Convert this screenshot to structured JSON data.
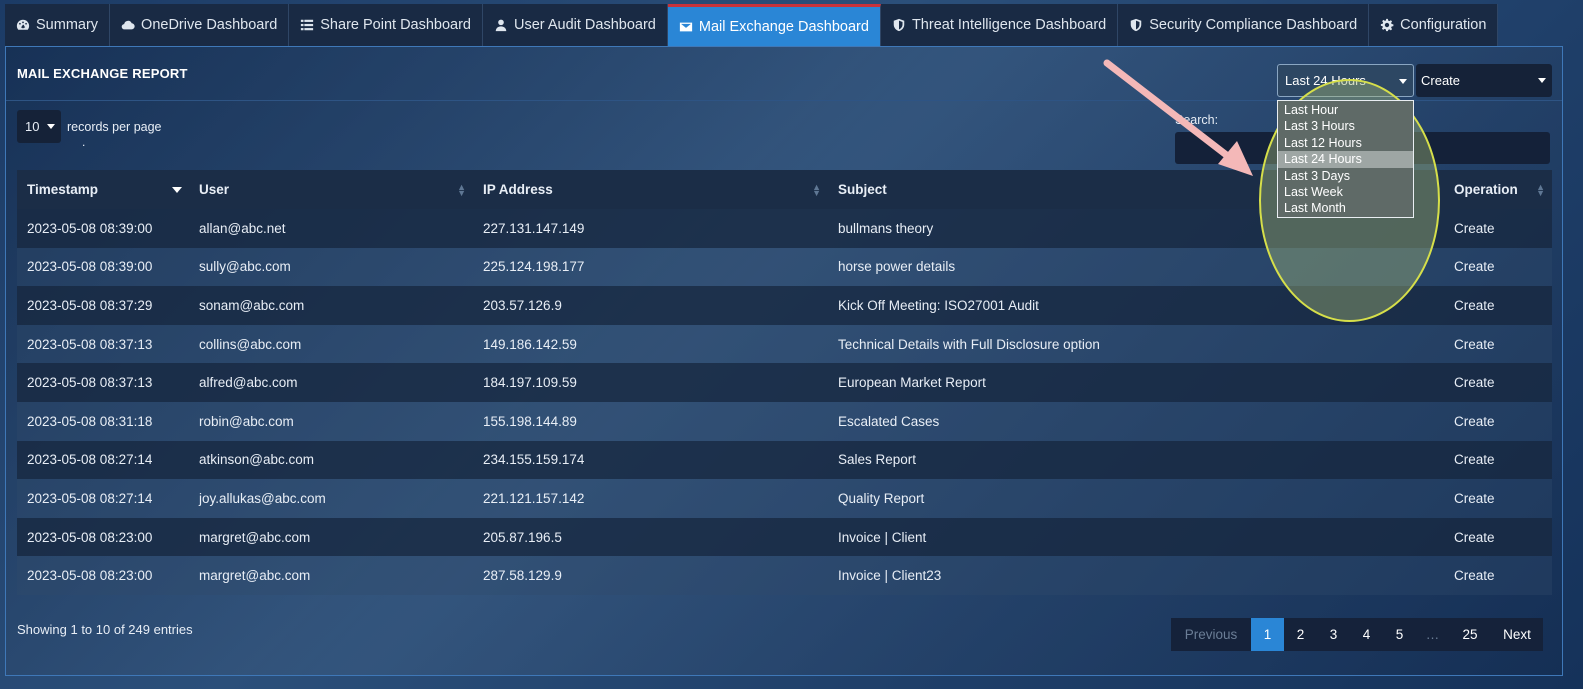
{
  "tabs": [
    {
      "label": "Summary",
      "icon": "dashboard-icon",
      "active": false
    },
    {
      "label": "OneDrive Dashboard",
      "icon": "cloud-icon",
      "active": false
    },
    {
      "label": "Share Point Dashboard",
      "icon": "list-icon",
      "active": false
    },
    {
      "label": "User Audit Dashboard",
      "icon": "user-icon",
      "active": false
    },
    {
      "label": "Mail Exchange Dashboard",
      "icon": "envelope-icon",
      "active": true
    },
    {
      "label": "Threat Intelligence Dashboard",
      "icon": "shield-icon",
      "active": false
    },
    {
      "label": "Security Compliance Dashboard",
      "icon": "shield-icon",
      "active": false
    },
    {
      "label": "Configuration",
      "icon": "gear-icon",
      "active": false
    }
  ],
  "report": {
    "title": "MAIL EXCHANGE REPORT",
    "time_filter": {
      "value": "Last 24 Hours",
      "options": [
        "Last Hour",
        "Last 3 Hours",
        "Last 12 Hours",
        "Last 24 Hours",
        "Last 3 Days",
        "Last Week",
        "Last Month"
      ]
    },
    "operation_filter": {
      "value": "Create"
    },
    "length": {
      "value": "10",
      "label": "records per page",
      "dot": "."
    },
    "search": {
      "label": "Search:",
      "value": ""
    }
  },
  "table": {
    "headers": [
      "Timestamp",
      "User",
      "IP Address",
      "Subject",
      "Operation"
    ],
    "rows": [
      [
        "2023-05-08 08:39:00",
        "allan@abc.net",
        "227.131.147.149",
        "bullmans theory",
        "Create"
      ],
      [
        "2023-05-08 08:39:00",
        "sully@abc.com",
        "225.124.198.177",
        "horse power details",
        "Create"
      ],
      [
        "2023-05-08 08:37:29",
        "sonam@abc.com",
        "203.57.126.9",
        "Kick Off Meeting: ISO27001 Audit",
        "Create"
      ],
      [
        "2023-05-08 08:37:13",
        "collins@abc.com",
        "149.186.142.59",
        "Technical Details with Full Disclosure option",
        "Create"
      ],
      [
        "2023-05-08 08:37:13",
        "alfred@abc.com",
        "184.197.109.59",
        "European Market Report",
        "Create"
      ],
      [
        "2023-05-08 08:31:18",
        "robin@abc.com",
        "155.198.144.89",
        "Escalated Cases",
        "Create"
      ],
      [
        "2023-05-08 08:27:14",
        "atkinson@abc.com",
        "234.155.159.174",
        "Sales Report",
        "Create"
      ],
      [
        "2023-05-08 08:27:14",
        "joy.allukas@abc.com",
        "221.121.157.142",
        "Quality Report",
        "Create"
      ],
      [
        "2023-05-08 08:23:00",
        "margret@abc.com",
        "205.87.196.5",
        "Invoice | Client",
        "Create"
      ],
      [
        "2023-05-08 08:23:00",
        "margret@abc.com",
        "287.58.129.9",
        "Invoice | Client23",
        "Create"
      ]
    ]
  },
  "footer": {
    "info": "Showing 1 to 10 of 249 entries",
    "pagination": {
      "previous": "Previous",
      "pages": [
        "1",
        "2",
        "3",
        "4",
        "5"
      ],
      "ellipsis": "…",
      "last": "25",
      "next": "Next",
      "current": "1"
    }
  },
  "colors": {
    "active_tab": "#2a86d6",
    "active_tab_top": "#c8323a",
    "highlight_oval": "#d6df4a",
    "arrow": "#f4b8b8"
  }
}
